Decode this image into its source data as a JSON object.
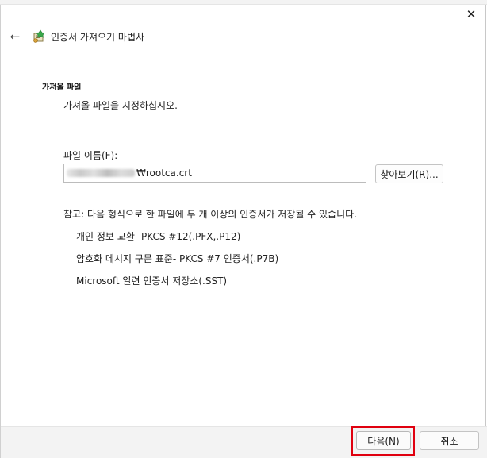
{
  "window": {
    "title": "인증서 가져오기 마법사",
    "close_icon": "close-icon",
    "back_icon": "back-arrow-icon",
    "wizard_icon": "certificate-wizard-icon"
  },
  "section": {
    "title": "가져올 파일",
    "description": "가져올 파일을 지정하십시오."
  },
  "file": {
    "label": "파일 이름(F):",
    "value_suffix": "₩rootca.crt",
    "browse_label": "찾아보기(R)..."
  },
  "note": {
    "text": "참고: 다음 형식으로 한 파일에 두 개 이상의 인증서가 저장될 수 있습니다.",
    "formats": [
      "개인 정보 교환- PKCS #12(.PFX,.P12)",
      "암호화 메시지 구문 표준- PKCS #7 인증서(.P7B)",
      "Microsoft 일련 인증서 저장소(.SST)"
    ]
  },
  "footer": {
    "next_label": "다음(N)",
    "cancel_label": "취소",
    "highlight_color": "#e0000f"
  }
}
